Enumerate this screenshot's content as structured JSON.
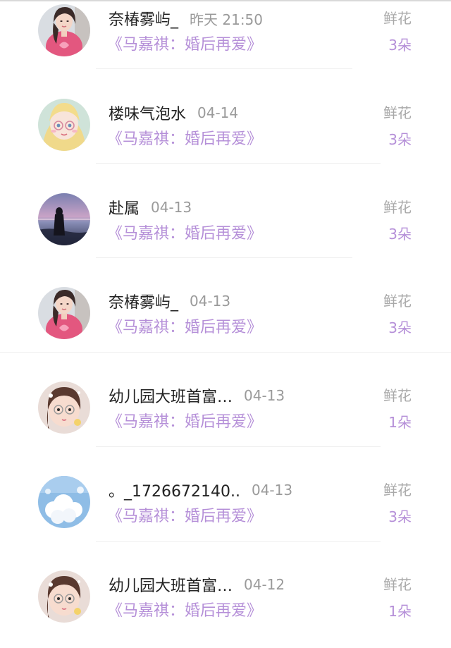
{
  "colors": {
    "name": "#222222",
    "time": "#9a9a9a",
    "book_title": "#b58fd8",
    "gift_label": "#a9a9a9",
    "gift_count": "#b58fd8",
    "divider": "#efefef"
  },
  "records": [
    {
      "avatar": "girl-pink-dress-avatar",
      "name": "奈椿雾屿_",
      "time": "昨天 21:50",
      "book": "《马嘉祺：婚后再爱》",
      "gift_type": "鲜花",
      "count": "3朵"
    },
    {
      "avatar": "anime-girl-avatar",
      "name": "楼味气泡水",
      "time": "04-14",
      "book": "《马嘉祺：婚后再爱》",
      "gift_type": "鲜花",
      "count": "3朵"
    },
    {
      "avatar": "sea-silhouette-avatar",
      "name": "赴属",
      "time": "04-13",
      "book": "《马嘉祺：婚后再爱》",
      "gift_type": "鲜花",
      "count": "3朵"
    },
    {
      "avatar": "girl-pink-dress-avatar",
      "name": "奈椿雾屿_",
      "time": "04-13",
      "book": "《马嘉祺：婚后再爱》",
      "gift_type": "鲜花",
      "count": "3朵"
    },
    {
      "avatar": "child-glasses-avatar",
      "name": "幼儿园大班首富…",
      "time": "04-13",
      "book": "《马嘉祺：婚后再爱》",
      "gift_type": "鲜花",
      "count": "1朵"
    },
    {
      "avatar": "cloud-sky-avatar",
      "name": "。_1726672140..",
      "time": "04-13",
      "book": "《马嘉祺：婚后再爱》",
      "gift_type": "鲜花",
      "count": "3朵"
    },
    {
      "avatar": "child-glasses-avatar",
      "name": "幼儿园大班首富…",
      "time": "04-12",
      "book": "《马嘉祺：婚后再爱》",
      "gift_type": "鲜花",
      "count": "1朵"
    }
  ]
}
